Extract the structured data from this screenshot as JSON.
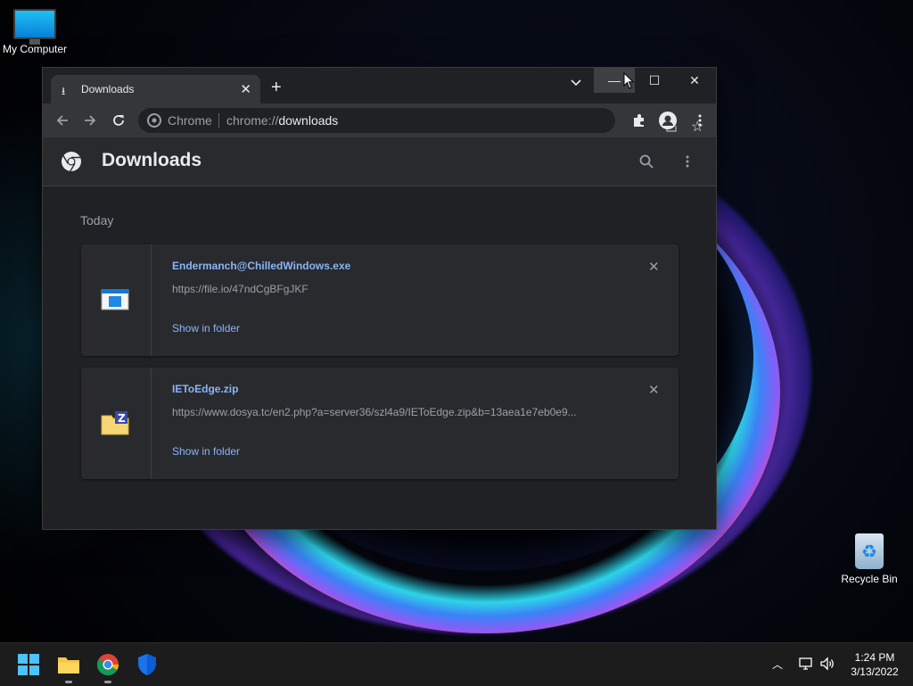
{
  "desktop": {
    "icons": [
      {
        "label": "My Computer"
      },
      {
        "label": "Recycle Bin"
      }
    ]
  },
  "browser": {
    "tab": {
      "title": "Downloads"
    },
    "omnibox": {
      "site_name": "Chrome",
      "url_prefix": "chrome://",
      "url_path": "downloads"
    }
  },
  "downloads_page": {
    "title": "Downloads",
    "section": "Today",
    "items": [
      {
        "name": "Endermanch@ChilledWindows.exe",
        "url": "https://file.io/47ndCgBFgJKF",
        "action": "Show in folder",
        "icon": "exe-file-icon"
      },
      {
        "name": "IEToEdge.zip",
        "url": "https://www.dosya.tc/en2.php?a=server36/szl4a9/IEToEdge.zip&b=13aea1e7eb0e9...",
        "action": "Show in folder",
        "icon": "zip-folder-icon"
      }
    ]
  },
  "taskbar": {
    "apps": [
      "start-icon",
      "file-explorer-icon",
      "chrome-icon",
      "windows-security-icon"
    ],
    "clock": {
      "time": "1:24 PM",
      "date": "3/13/2022"
    }
  },
  "colors": {
    "accent_link": "#8ab4f8",
    "window_bg": "#202124",
    "toolbar_bg": "#35363a",
    "taskbar_bg": "#1c1c1c"
  }
}
